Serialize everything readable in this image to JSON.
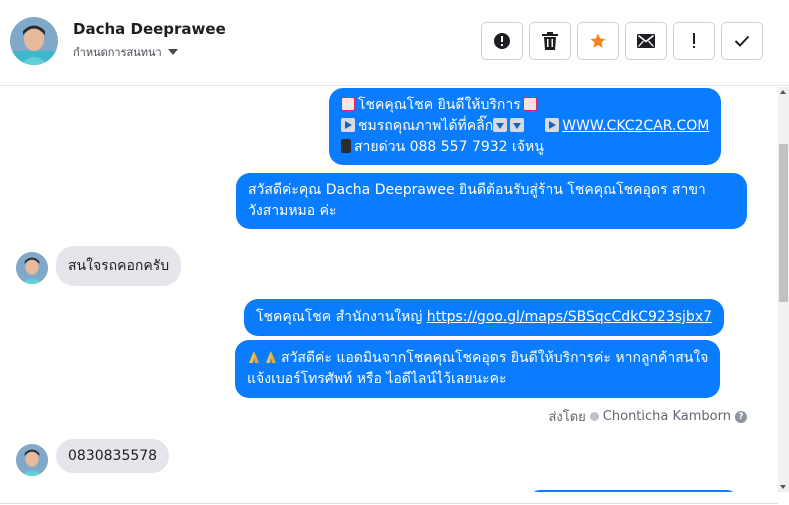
{
  "header": {
    "name": "Dacha Deeprawee",
    "subtitle": "กำหนดการสนทนา"
  },
  "toolbar": {
    "buttons": [
      {
        "icon": "alert-circle-icon"
      },
      {
        "icon": "trash-icon"
      },
      {
        "icon": "star-icon",
        "color": "#f5821f"
      },
      {
        "icon": "mail-icon"
      },
      {
        "icon": "exclamation-icon"
      },
      {
        "icon": "check-icon"
      }
    ]
  },
  "messages": {
    "m1": {
      "line1": "โชคคุณโชค ยินดีให้บริการ",
      "line2_text": "ชมรถคุณภาพได้ที่คลิ๊ก",
      "line2_link": "WWW.CKC2CAR.COM",
      "line3": "สายด่วน 088 557 7932 เจ้หนู"
    },
    "m2": {
      "line1": "สวัสดีค่ะคุณ Dacha Deeprawee ยินดีต้อนรับสู่ร้าน โชคคุณโชคอุดร สาขา",
      "line2": "วังสามหมอ ค่ะ"
    },
    "m3": {
      "text": "สนใจรถคอกครับ"
    },
    "m4": {
      "text": "โชคคุณโชค สำนักงานใหญ่ ",
      "link": "https://goo.gl/maps/SBSqcCdkC923sjbx7"
    },
    "m5": {
      "line1": "สวัสดีค่ะ แอดมินจากโชคคุณโชคอุดร ยินดีให้บริการค่ะ หากลูกค้าสนใจ",
      "line2": "แจ้งเบอร์โทรศัพท์ หรือ ไอดีไลน์ไว้เลยนะคะ"
    },
    "sent_by": {
      "label": "ส่งโดย",
      "name": "Chonticha Kamborn"
    },
    "m6": {
      "text": "0830835578"
    }
  },
  "colors": {
    "outgoing": "#0a7cff",
    "incoming": "#e4e6eb",
    "star": "#f5821f"
  }
}
